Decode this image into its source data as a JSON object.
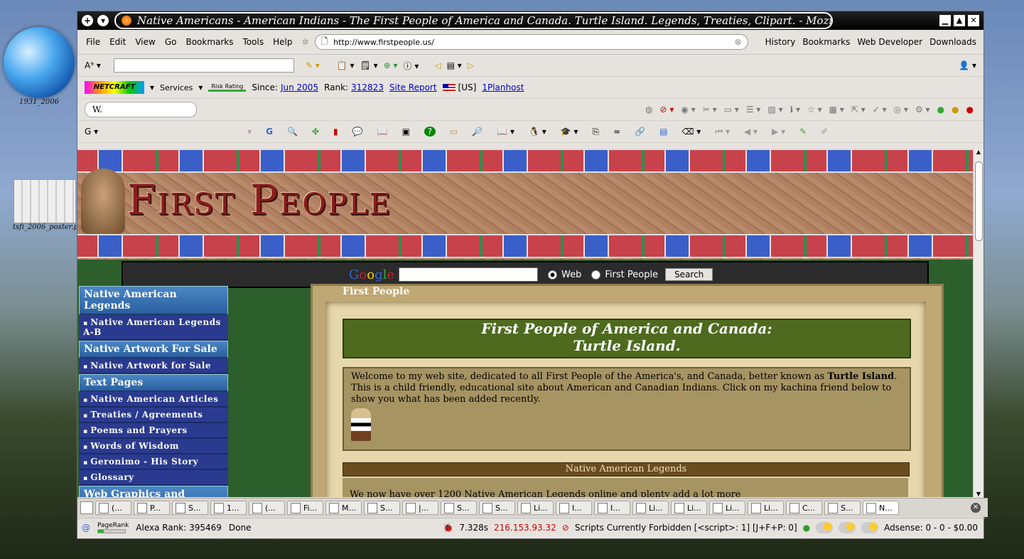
{
  "desktop": {
    "icon1_label": "1931_2006",
    "icon2_label": "tsfi_2006_poster.pdf"
  },
  "window": {
    "title": "Native Americans - American Indians - The First People of America and Canada. Turtle Island. Legends, Treaties, Clipart. - Mozilla Firefox"
  },
  "menu": {
    "file": "File",
    "edit": "Edit",
    "view": "View",
    "go": "Go",
    "bookmarks": "Bookmarks",
    "tools": "Tools",
    "help": "Help",
    "url": "http://www.firstpeople.us/",
    "history": "History",
    "bookmarks2": "Bookmarks",
    "webdev": "Web Developer",
    "downloads": "Downloads"
  },
  "netcraft": {
    "logo": "NETCRAFT",
    "services": "Services",
    "risk": "Risk Rating",
    "since_label": "Since:",
    "since": "Jun 2005",
    "rank_label": "Rank:",
    "rank": "312823",
    "report": "Site Report",
    "country": "[US]",
    "host": "1Planhost"
  },
  "search_box": {
    "value": "W."
  },
  "page": {
    "banner_text": "First People",
    "google": {
      "logo": "Google",
      "web": "Web",
      "site": "First People",
      "button": "Search"
    },
    "sidebar": [
      {
        "type": "head",
        "label": "Native American Legends"
      },
      {
        "type": "item",
        "label": "Native American Legends A-B"
      },
      {
        "type": "head",
        "label": "Native Artwork For Sale"
      },
      {
        "type": "item",
        "label": "Native Artwork for Sale"
      },
      {
        "type": "head",
        "label": "Text Pages"
      },
      {
        "type": "item",
        "label": "Native American Articles"
      },
      {
        "type": "item",
        "label": "Treaties / Agreements"
      },
      {
        "type": "item",
        "label": "Poems and Prayers"
      },
      {
        "type": "item",
        "label": "Words of Wisdom"
      },
      {
        "type": "item",
        "label": "Geronimo - His Story"
      },
      {
        "type": "item",
        "label": "Glossary"
      },
      {
        "type": "head",
        "label": "Web Graphics and Clipart"
      }
    ],
    "panel_title": "First People",
    "hero_line1": "First People of America and Canada:",
    "hero_line2": "Turtle Island.",
    "welcome_a": "Welcome to my web site, dedicated to all First People of the America's, and Canada, better known as ",
    "welcome_bold": "Turtle Island",
    "welcome_b": ". This is a child friendly, educational site about American and Canadian Indians. Click on my kachina friend below to show you what has been added recently.",
    "legends_bar": "Native American Legends",
    "legends_text": "We now have over 1200 Native American Legends online and plenty add a lot more"
  },
  "tabs": [
    "(...",
    "P...",
    "S...",
    "1...",
    "(...",
    "Fi...",
    "M...",
    "S...",
    "|...",
    "S...",
    "S...",
    "Li...",
    "I...",
    "I...",
    "Li...",
    "Li...",
    "Li...",
    "Li...",
    "C...",
    "S...",
    "N..."
  ],
  "status": {
    "pagerank": "PageRank",
    "alexa": "Alexa Rank: 395469",
    "done": "Done",
    "time": "7.328s",
    "ip": "216.153.93.32",
    "scripts": "Scripts Currently Forbidden [<script>: 1] [J+F+P: 0]",
    "adsense": "Adsense: 0 - 0 - $0.00"
  }
}
